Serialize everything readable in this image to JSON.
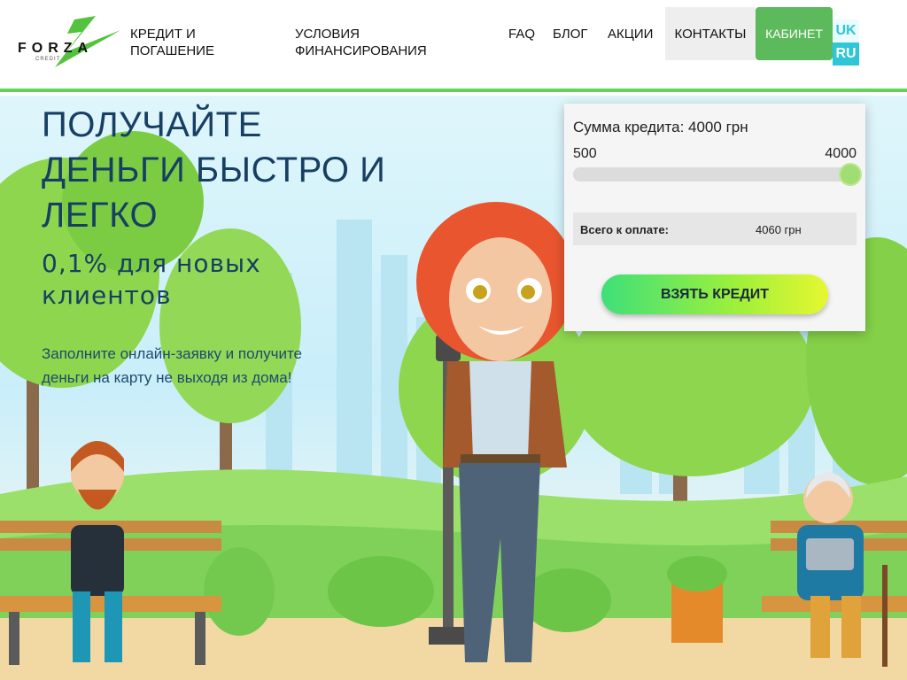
{
  "header": {
    "logo_text": "FORZA",
    "logo_sub": "CREDIT",
    "nav": {
      "credit": "Кредит и погашение",
      "terms": "Условия финансирования",
      "faq": "FAQ",
      "blog": "Блог",
      "promo": "Акции",
      "contacts": "Контакты"
    },
    "cabinet_label": "Кабинет",
    "lang": {
      "uk": "UK",
      "ru": "RU"
    }
  },
  "hero": {
    "title": "Получайте деньги быстро и легко",
    "subtitle": "0,1% для новых клиентов",
    "description": "Заполните онлайн-заявку и получите деньги на карту не выходя из дома!"
  },
  "calculator": {
    "title": "Сумма кредита: 4000 грн",
    "min_label": "500",
    "max_label": "4000",
    "slider": {
      "min": 500,
      "max": 4000,
      "value": 4000
    },
    "total_label": "Всего к оплате:",
    "total_value": "4060 грн",
    "button_label": "Взять кредит"
  },
  "colors": {
    "accent_green": "#5fd35a",
    "cabinet_green": "#5cba5c",
    "lang_cyan": "#2fc6d8",
    "title_blue": "#173f63"
  }
}
